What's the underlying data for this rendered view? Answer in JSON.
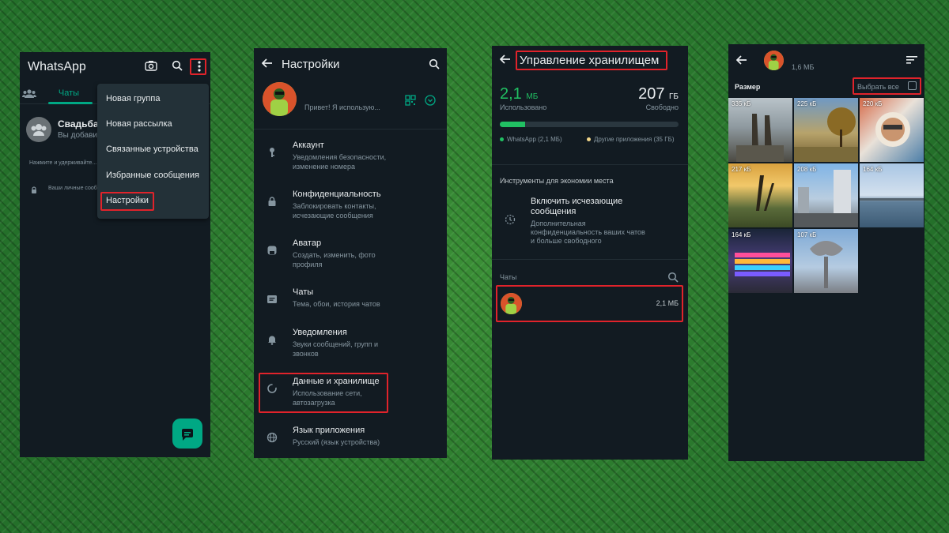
{
  "panel1": {
    "app_title": "WhatsApp",
    "tab_chats": "Чаты",
    "chat": {
      "name": "Свадьба ...",
      "preview": "Вы добавил..."
    },
    "hint": "Нажмите и удерживайте...",
    "encryption_note": "Ваши личные сооб...",
    "menu": [
      "Новая группа",
      "Новая рассылка",
      "Связанные устройства",
      "Избранные сообщения",
      "Настройки"
    ]
  },
  "panel2": {
    "title": "Настройки",
    "profile_status": "Привет! Я использую...",
    "items": [
      {
        "title": "Аккаунт",
        "subtitle": "Уведомления безопасности, изменение номера",
        "icon": "key-icon"
      },
      {
        "title": "Конфиденциальность",
        "subtitle": "Заблокировать контакты, исчезающие сообщения",
        "icon": "lock-icon"
      },
      {
        "title": "Аватар",
        "subtitle": "Создать, изменить, фото профиля",
        "icon": "avatar-icon"
      },
      {
        "title": "Чаты",
        "subtitle": "Тема, обои, история чатов",
        "icon": "chat-icon"
      },
      {
        "title": "Уведомления",
        "subtitle": "Звуки сообщений, групп и звонков",
        "icon": "bell-icon"
      },
      {
        "title": "Данные и хранилище",
        "subtitle": "Использование сети, автозагрузка",
        "icon": "storage-icon"
      },
      {
        "title": "Язык приложения",
        "subtitle": "Русский (язык устройства)",
        "icon": "globe-icon"
      }
    ]
  },
  "panel3": {
    "title": "Управление хранилищем",
    "used_value": "2,1",
    "used_unit": "МБ",
    "used_label": "Использовано",
    "free_value": "207",
    "free_unit": "ГБ",
    "free_label": "Свободно",
    "usage_fraction_whatsapp": 0.14,
    "usage_fraction_other": 0.0,
    "legend_whatsapp": "WhatsApp (2,1 МБ)",
    "legend_other": "Другие приложения (35 ГБ)",
    "colors": {
      "whatsapp": "#21c063",
      "other": "#f1d68a"
    },
    "tools_header": "Инструменты для экономии места",
    "disappearing_title": "Включить исчезающие сообщения",
    "disappearing_subtitle": "Дополнительная конфиденциальность ваших чатов и больше свободного",
    "chats_header": "Чаты",
    "chat_size": "2,1 МБ"
  },
  "panel4": {
    "total_size": "1,6 МБ",
    "sort_label": "Размер",
    "select_all": "Выбрать все",
    "tiles": [
      "335 кБ",
      "225 кБ",
      "220 кБ",
      "217 кБ",
      "208 кБ",
      "164 кБ",
      "164 кБ",
      "107 кБ"
    ]
  },
  "highlight_color": "#e0232b",
  "accent_color": "#00a884"
}
